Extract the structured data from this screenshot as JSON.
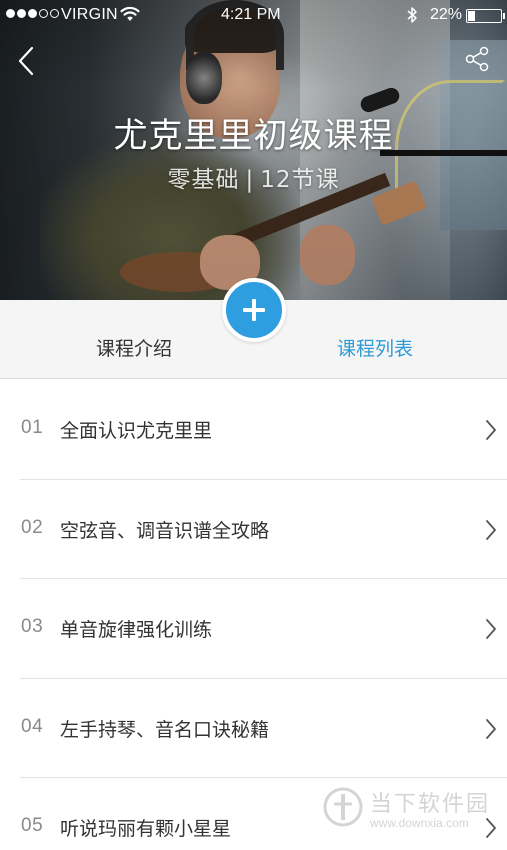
{
  "status_bar": {
    "carrier": "VIRGIN",
    "time": "4:21 PM",
    "battery_percent": "22%",
    "battery_level": 0.22,
    "signal_dots_filled": 3,
    "signal_dots_total": 5
  },
  "icons": {
    "back": "chevron-left-icon",
    "share": "share-icon",
    "add": "plus-icon",
    "row_arrow": "chevron-right-icon"
  },
  "course": {
    "title": "尤克里里初级课程",
    "level": "零基础",
    "separator": "|",
    "lesson_count": "12节课"
  },
  "tabs": {
    "intro": "课程介绍",
    "list": "课程列表",
    "active": "list"
  },
  "colors": {
    "accent": "#2f9ee0",
    "active_tab": "#2f9bd6"
  },
  "lessons": [
    {
      "num": "01",
      "title": "全面认识尤克里里"
    },
    {
      "num": "02",
      "title": "空弦音、调音识谱全攻略"
    },
    {
      "num": "03",
      "title": "单音旋律强化训练"
    },
    {
      "num": "04",
      "title": "左手持琴、音名口诀秘籍"
    },
    {
      "num": "05",
      "title": "听说玛丽有颗小星星"
    }
  ],
  "watermark": {
    "name": "当下软件园",
    "url": "www.downxia.com"
  }
}
